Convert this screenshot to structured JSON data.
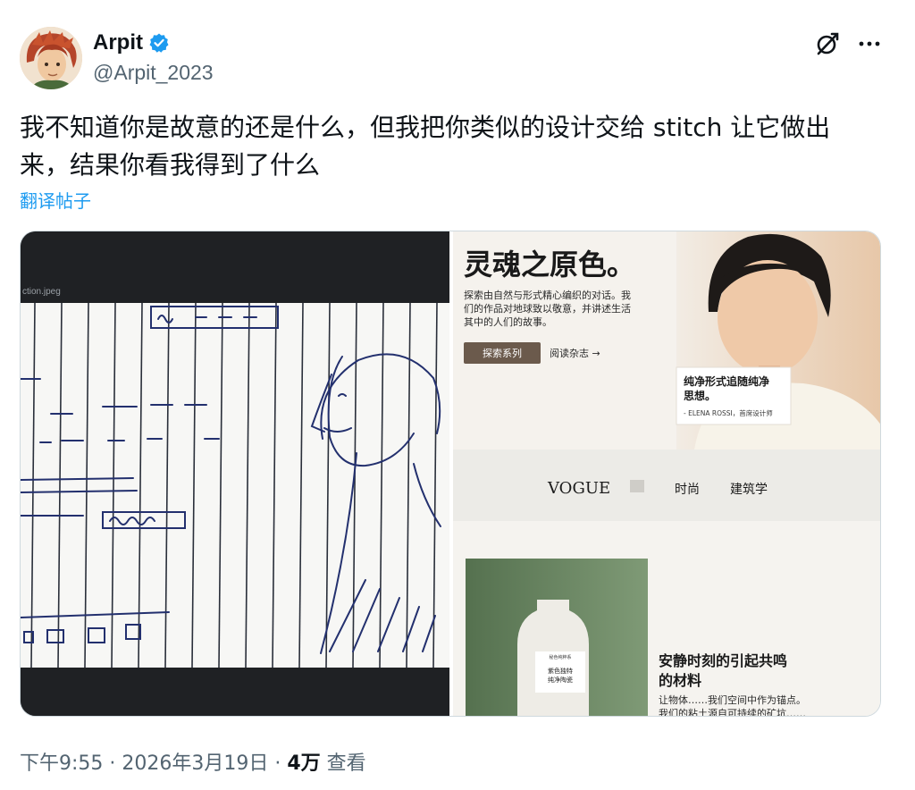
{
  "author": {
    "display_name": "Arpit",
    "handle": "@Arpit_2023",
    "verified_color": "#1d9bf0"
  },
  "header_icons": [
    "grok-icon",
    "more-icon"
  ],
  "tweet": {
    "text": "我不知道你是故意的还是什么，但我把你类似的设计交给 stitch 让它做出来，结果你看我得到了什么",
    "translate_label": "翻译帖子"
  },
  "sketch": {
    "filename": "ction.jpeg"
  },
  "design": {
    "hero_title": "灵魂之原色。",
    "hero_body": [
      "探索由自然与形式精心编织的对话。我",
      "们的作品对地球致以敬意，并讲述生活",
      "其中的人们的故事。"
    ],
    "explore_button": "探索系列",
    "read_link": "阅读杂志 →",
    "quote_title": [
      "纯净形式追随纯净",
      "思想。"
    ],
    "quote_author": "- ELENA ROSSI，首席设计师",
    "nav": {
      "brand": "VOGUE",
      "item1": "时尚",
      "item2": "建筑学"
    },
    "product_label": [
      "紫色独特",
      "纯净陶瓷"
    ],
    "product_brand": "秘色纯粹系",
    "section_title": [
      "安静时刻的引起共鸣",
      "的材料"
    ],
    "section_body": [
      "让物体……我们空间中作为锚点。",
      "我们的粘土源自可持续的矿坑……"
    ]
  },
  "footer": {
    "time": "下午9:55",
    "sep1": " · ",
    "date": "2026年3月19日",
    "sep2": " · ",
    "views_count": "4万",
    "views_label": " 查看"
  }
}
